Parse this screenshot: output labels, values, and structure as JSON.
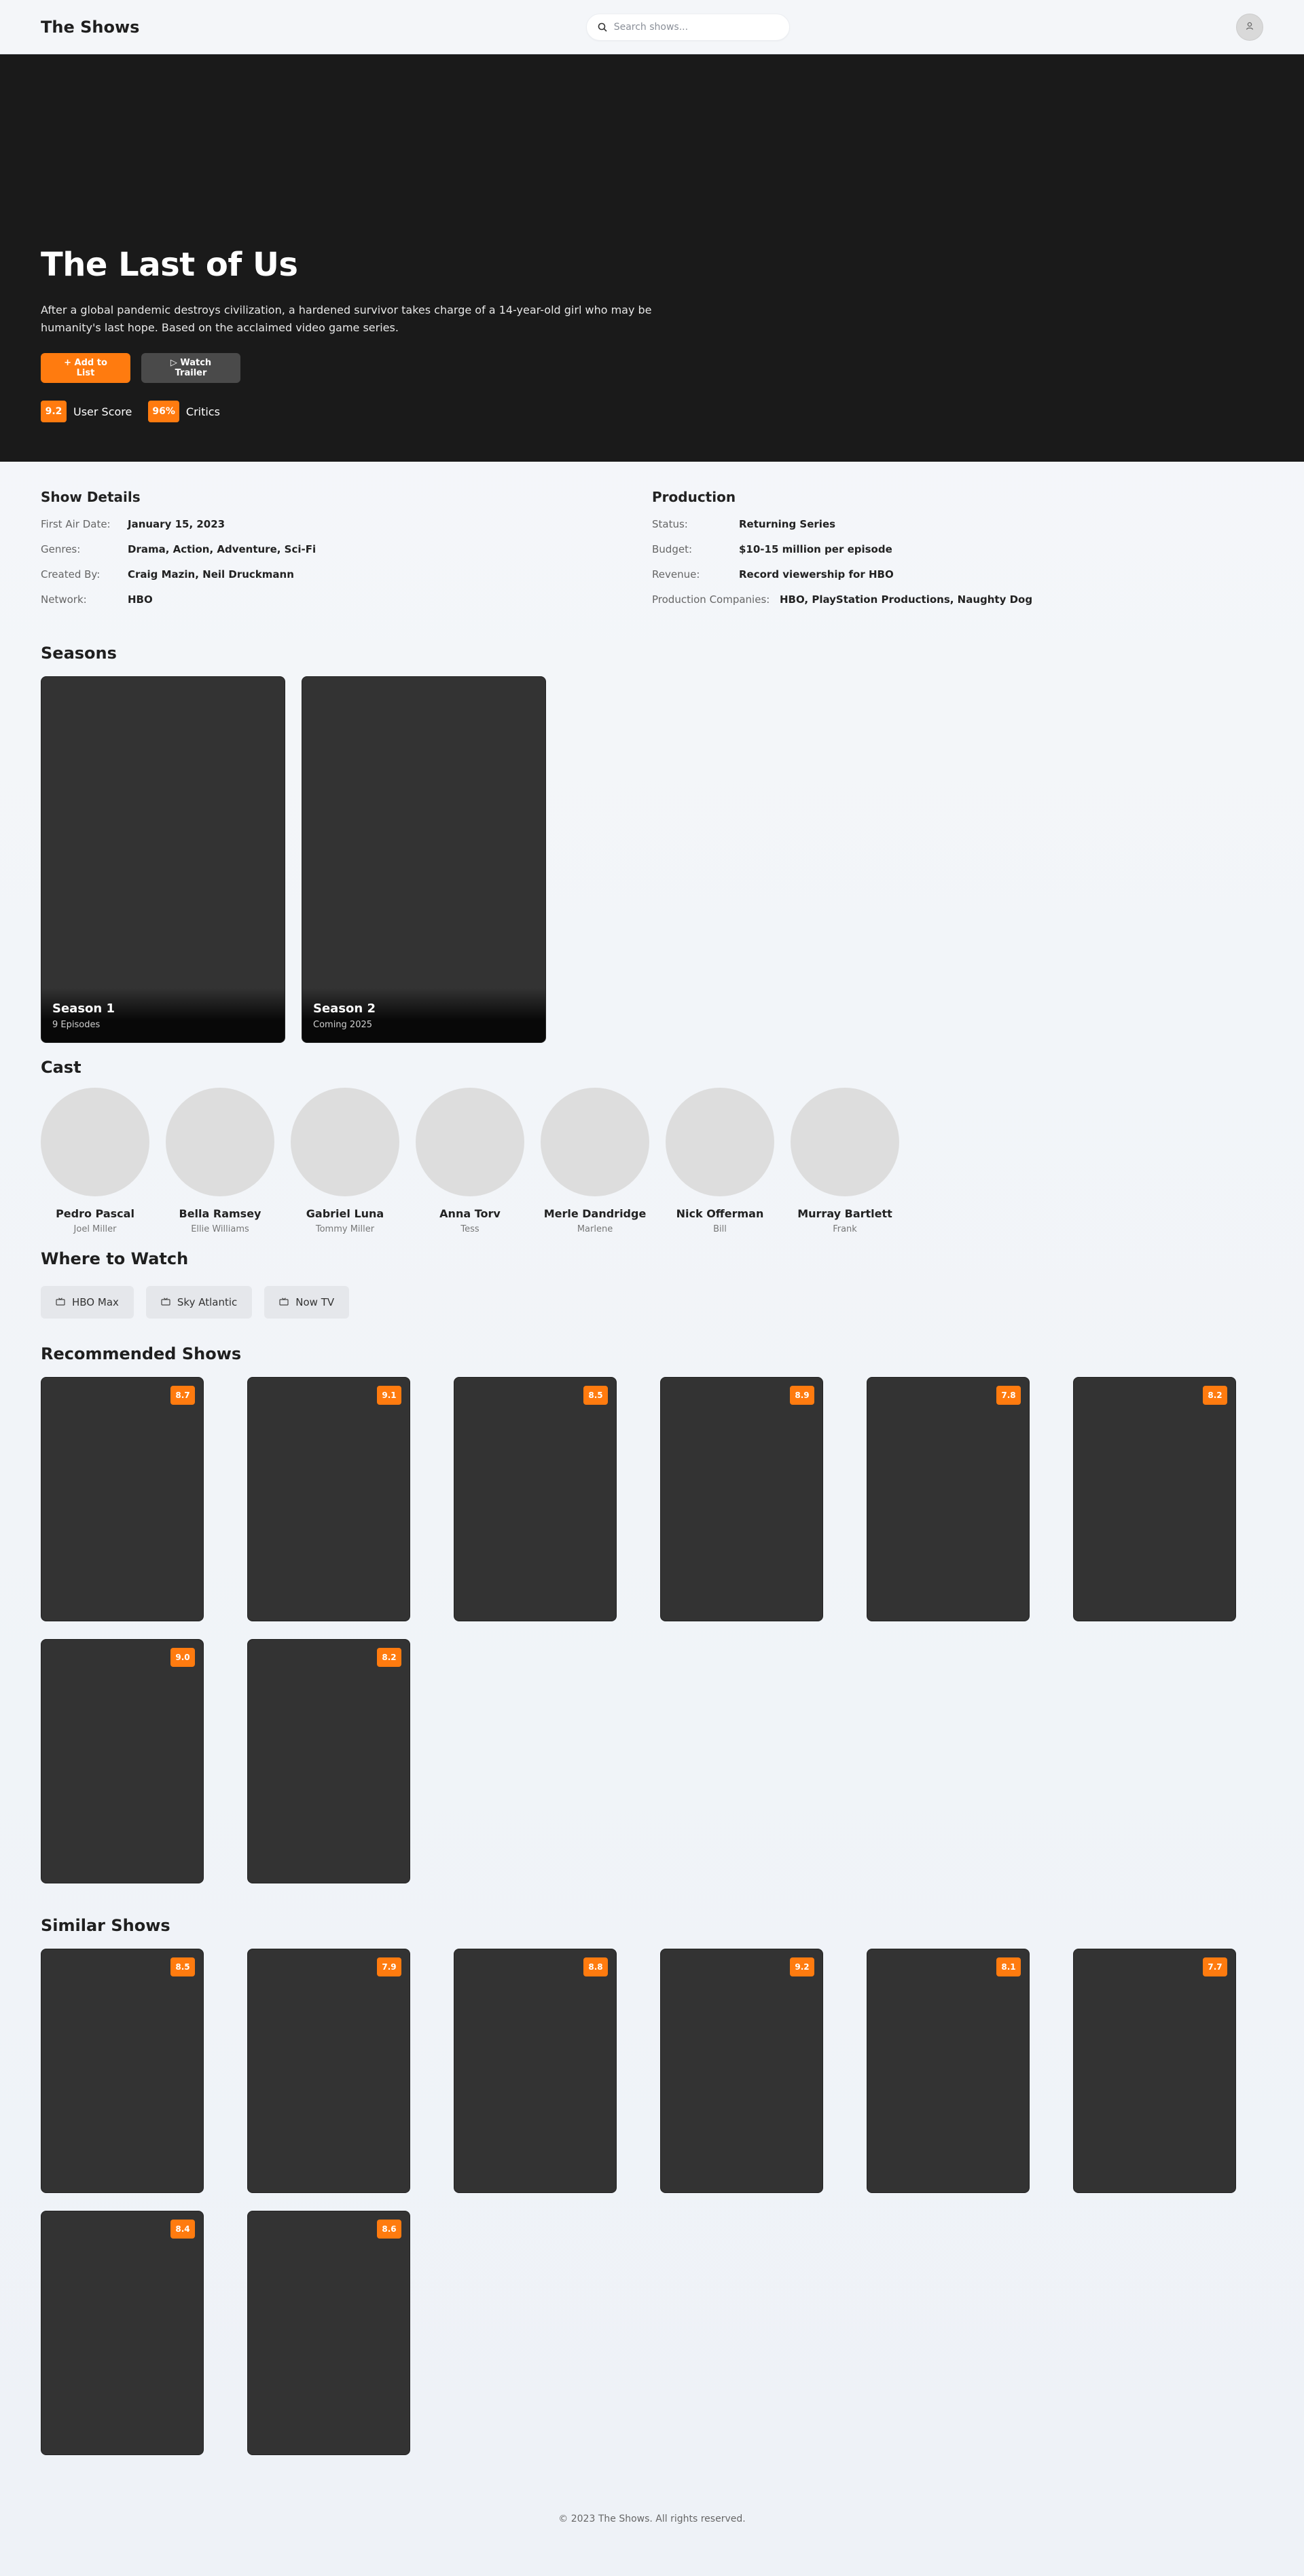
{
  "header": {
    "brand": "The Shows",
    "search_placeholder": "Search shows...",
    "avatar_icon": "user-icon"
  },
  "hero": {
    "title": "The Last of Us",
    "description": "After a global pandemic destroys civilization, a hardened survivor takes charge of a 14-year-old girl who may be humanity's last hope. Based on the acclaimed video game series.",
    "add_button": "+ Add to List",
    "trailer_button": "▷ Watch Trailer",
    "user_score": "9.2",
    "user_score_label": "User Score",
    "critics_score": "96%",
    "critics_label": "Critics"
  },
  "show_details": {
    "title": "Show Details",
    "rows": [
      {
        "label": "First Air Date:",
        "value": "January 15, 2023"
      },
      {
        "label": "Genres:",
        "value": "Drama, Action, Adventure, Sci-Fi"
      },
      {
        "label": "Created By:",
        "value": "Craig Mazin, Neil Druckmann"
      },
      {
        "label": "Network:",
        "value": "HBO"
      }
    ]
  },
  "production": {
    "title": "Production",
    "rows": [
      {
        "label": "Status:",
        "value": "Returning Series"
      },
      {
        "label": "Budget:",
        "value": "$10-15 million per episode"
      },
      {
        "label": "Revenue:",
        "value": "Record viewership for HBO"
      },
      {
        "label": "Production Companies:",
        "value": "HBO, PlayStation Productions, Naughty Dog"
      }
    ]
  },
  "seasons": {
    "title": "Seasons",
    "items": [
      {
        "name": "Season 1",
        "sub": "9 Episodes"
      },
      {
        "name": "Season 2",
        "sub": "Coming 2025"
      }
    ]
  },
  "cast": {
    "title": "Cast",
    "items": [
      {
        "name": "Pedro Pascal",
        "role": "Joel Miller"
      },
      {
        "name": "Bella Ramsey",
        "role": "Ellie Williams"
      },
      {
        "name": "Gabriel Luna",
        "role": "Tommy Miller"
      },
      {
        "name": "Anna Torv",
        "role": "Tess"
      },
      {
        "name": "Merle Dandridge",
        "role": "Marlene"
      },
      {
        "name": "Nick Offerman",
        "role": "Bill"
      },
      {
        "name": "Murray Bartlett",
        "role": "Frank"
      }
    ]
  },
  "where_to_watch": {
    "title": "Where to Watch",
    "providers": [
      "HBO Max",
      "Sky Atlantic",
      "Now TV"
    ]
  },
  "recommended": {
    "title": "Recommended Shows",
    "ratings": [
      "8.7",
      "9.1",
      "8.5",
      "8.9",
      "7.8",
      "8.2",
      "9.0",
      "8.2"
    ]
  },
  "similar": {
    "title": "Similar Shows",
    "ratings": [
      "8.5",
      "7.9",
      "8.8",
      "9.2",
      "8.1",
      "7.7",
      "8.4",
      "8.6"
    ]
  },
  "footer": {
    "text": "© 2023 The Shows. All rights reserved."
  },
  "colors": {
    "accent": "#ff7b0f",
    "hero_bg": "#1a1a1a",
    "card_bg": "#333333"
  }
}
